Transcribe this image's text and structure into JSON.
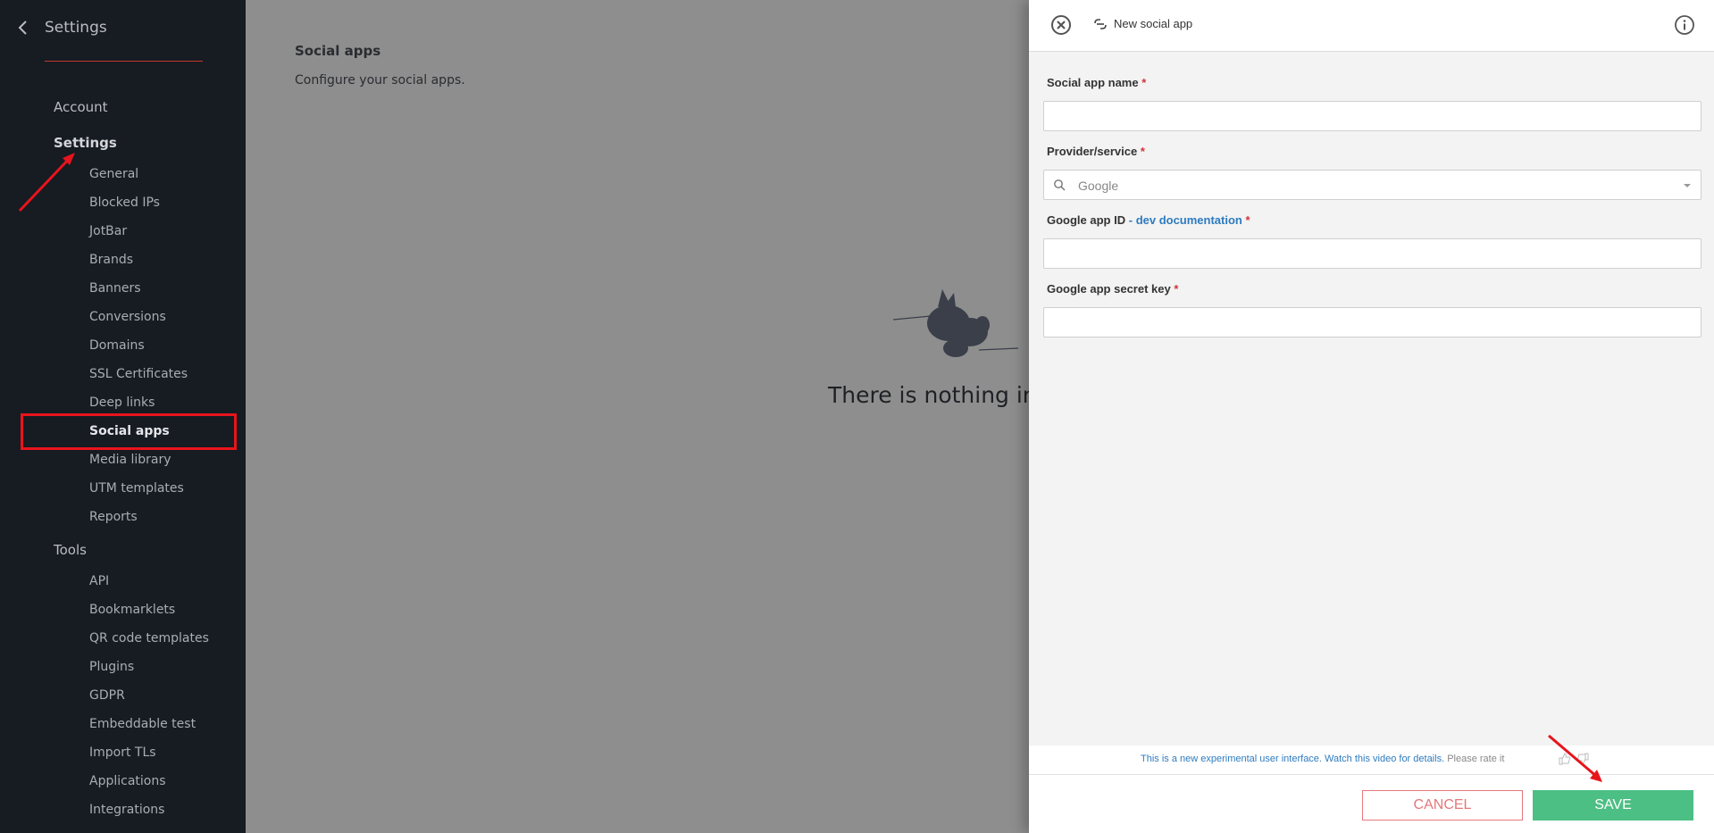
{
  "sidebar": {
    "title": "Settings",
    "groups": [
      {
        "label": "Account"
      },
      {
        "label": "Settings"
      },
      {
        "label": "Tools"
      }
    ],
    "settings_items": [
      "General",
      "Blocked IPs",
      "JotBar",
      "Brands",
      "Banners",
      "Conversions",
      "Domains",
      "SSL Certificates",
      "Deep links",
      "Social apps",
      "Media library",
      "UTM templates",
      "Reports"
    ],
    "tools_items": [
      "API",
      "Bookmarklets",
      "QR code templates",
      "Plugins",
      "GDPR",
      "Embeddable test",
      "Import TLs",
      "Applications",
      "Integrations"
    ],
    "active_item": "Social apps"
  },
  "main": {
    "title": "Social apps",
    "subtitle": "Configure your social apps.",
    "empty_text": "There is nothing in"
  },
  "panel": {
    "title": "New social app",
    "fields": {
      "name_label": "Social app name",
      "provider_label": "Provider/service",
      "provider_value": "Google",
      "app_id_label": "Google app ID",
      "app_id_sep": " - ",
      "app_id_link": "dev documentation",
      "secret_label": "Google app secret key",
      "required_mark": "*"
    },
    "notice": {
      "text": "This is a new experimental user interface. Watch this video for details.",
      "rate": "Please rate it"
    },
    "cancel_label": "CANCEL",
    "save_label": "SAVE"
  },
  "colors": {
    "sidebar_bg": "#171b22",
    "accent_red": "#e8141c",
    "save_green": "#4cbf84",
    "cancel_red": "#e5787c",
    "link_blue": "#2e7bbf"
  }
}
